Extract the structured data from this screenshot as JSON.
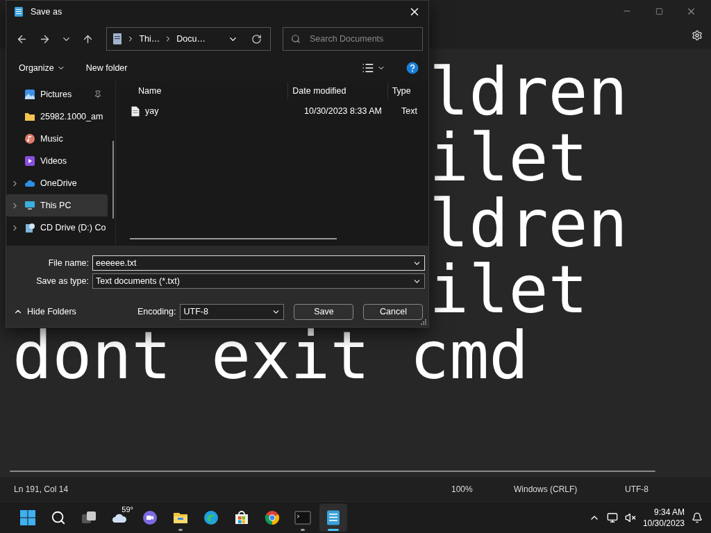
{
  "editor": {
    "lines": [
      {
        "text": "ldren",
        "kind": "partial"
      },
      {
        "text": "ilet",
        "kind": "partial"
      },
      {
        "text": "ldren",
        "kind": "partial"
      },
      {
        "text": "ilet",
        "kind": "partial"
      },
      {
        "text": "dont exit cmd",
        "kind": "full"
      }
    ]
  },
  "status_bar": {
    "position": "Ln 191, Col 14",
    "zoom": "100%",
    "line_ending": "Windows (CRLF)",
    "encoding": "UTF-8"
  },
  "dialog": {
    "title": "Save as",
    "breadcrumbs": [
      "Thi…",
      "Docu…"
    ],
    "search": {
      "placeholder": "Search Documents"
    },
    "commands": {
      "organize": "Organize",
      "new_folder": "New folder"
    },
    "nav_items": [
      {
        "label": "Pictures",
        "kind": "pictures",
        "pinned": true,
        "expandable": false,
        "selected": false
      },
      {
        "label": "25982.1000_am",
        "kind": "folder",
        "pinned": false,
        "expandable": false,
        "selected": false
      },
      {
        "label": "Music",
        "kind": "music",
        "pinned": false,
        "expandable": false,
        "selected": false
      },
      {
        "label": "Videos",
        "kind": "videos",
        "pinned": false,
        "expandable": false,
        "selected": false
      },
      {
        "label": "OneDrive",
        "kind": "onedrive",
        "pinned": false,
        "expandable": true,
        "selected": false
      },
      {
        "label": "This PC",
        "kind": "pc",
        "pinned": false,
        "expandable": true,
        "selected": true
      },
      {
        "label": "CD Drive (D:) Co",
        "kind": "cd",
        "pinned": false,
        "expandable": true,
        "selected": false
      }
    ],
    "columns": [
      "Name",
      "Date modified",
      "Type"
    ],
    "rows": [
      {
        "name": "yay",
        "date": "10/30/2023 8:33 AM",
        "type": "Text"
      }
    ],
    "file_name": {
      "label": "File name:",
      "value": "eeeeee.txt"
    },
    "save_as_type": {
      "label": "Save as type:",
      "value": "Text documents (*.txt)"
    },
    "hide_folders": "Hide Folders",
    "encoding": {
      "label": "Encoding:",
      "value": "UTF-8"
    },
    "buttons": {
      "save": "Save",
      "cancel": "Cancel"
    }
  },
  "taskbar": {
    "apps": [
      {
        "kind": "start",
        "running": false,
        "selected": false
      },
      {
        "kind": "search",
        "running": false,
        "selected": false
      },
      {
        "kind": "taskview",
        "running": false,
        "selected": false
      },
      {
        "kind": "weather",
        "running": false,
        "selected": false,
        "badge": "59°"
      },
      {
        "kind": "chat",
        "running": false,
        "selected": false
      },
      {
        "kind": "explorer",
        "running": true,
        "selected": false
      },
      {
        "kind": "edge",
        "running": false,
        "selected": false
      },
      {
        "kind": "store",
        "running": false,
        "selected": false
      },
      {
        "kind": "chrome",
        "running": false,
        "selected": false
      },
      {
        "kind": "terminal",
        "running": true,
        "selected": false
      },
      {
        "kind": "notepad",
        "running": true,
        "selected": true
      }
    ],
    "time": "9:34 AM",
    "date": "10/30/2023"
  }
}
